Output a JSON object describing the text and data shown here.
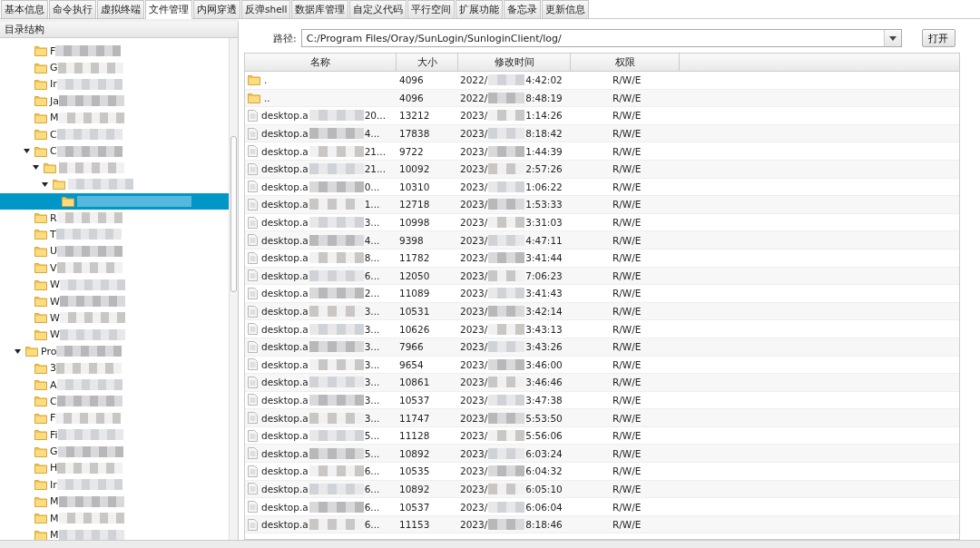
{
  "tabs": [
    {
      "label": "基本信息",
      "selected": false
    },
    {
      "label": "命令执行",
      "selected": false
    },
    {
      "label": "虚拟终端",
      "selected": false
    },
    {
      "label": "文件管理",
      "selected": true
    },
    {
      "label": "内网穿透",
      "selected": false
    },
    {
      "label": "反弹shell",
      "selected": false
    },
    {
      "label": "数据库管理",
      "selected": false
    },
    {
      "label": "自定义代码",
      "selected": false
    },
    {
      "label": "平行空间",
      "selected": false
    },
    {
      "label": "扩展功能",
      "selected": false
    },
    {
      "label": "备忘录",
      "selected": false
    },
    {
      "label": "更新信息",
      "selected": false
    }
  ],
  "tree_panel": {
    "title": "目录结构",
    "tree": [
      {
        "kind": "continued",
        "children": [
          {
            "label": "F",
            "expanded": false,
            "selected": false
          },
          {
            "label": "G",
            "expanded": false,
            "selected": false
          },
          {
            "label": "Ir",
            "expanded": false,
            "selected": false
          },
          {
            "label": "Ja",
            "expanded": false,
            "selected": false
          },
          {
            "label": "M",
            "expanded": false,
            "selected": false
          },
          {
            "label": "C",
            "expanded": false,
            "selected": false
          },
          {
            "label": "C",
            "expanded": true,
            "selected": false,
            "children": [
              {
                "expanded": true,
                "selected": false,
                "children": [
                  {
                    "expanded": true,
                    "selected": false,
                    "children": [
                      {
                        "expanded": false,
                        "selected": true
                      }
                    ]
                  }
                ]
              }
            ]
          },
          {
            "label": "R",
            "expanded": false,
            "selected": false
          },
          {
            "label": "T",
            "expanded": false,
            "selected": false
          },
          {
            "label": "U",
            "expanded": false,
            "selected": false
          },
          {
            "label": "V",
            "expanded": false,
            "selected": false
          },
          {
            "label": "W",
            "expanded": false,
            "selected": false
          },
          {
            "label": "W",
            "expanded": false,
            "selected": false
          },
          {
            "label": "W",
            "expanded": false,
            "selected": false
          },
          {
            "label": "W",
            "expanded": false,
            "selected": false
          }
        ]
      },
      {
        "kind": "folder",
        "label": "Pro",
        "expanded": true,
        "selected": false,
        "children": [
          {
            "label": "3",
            "expanded": false,
            "selected": false
          },
          {
            "label": "A",
            "expanded": false,
            "selected": false
          },
          {
            "label": "C",
            "expanded": false,
            "selected": false
          },
          {
            "label": "F",
            "expanded": false,
            "selected": false
          },
          {
            "label": "Fi",
            "expanded": false,
            "selected": false
          },
          {
            "label": "G",
            "expanded": false,
            "selected": false
          },
          {
            "label": "H",
            "expanded": false,
            "selected": false
          },
          {
            "label": "Ir",
            "expanded": false,
            "selected": false
          },
          {
            "label": "M",
            "expanded": false,
            "selected": false
          },
          {
            "label": "M",
            "expanded": false,
            "selected": false
          },
          {
            "label": "M",
            "expanded": false,
            "selected": false
          }
        ]
      }
    ]
  },
  "path_bar": {
    "label": "路径:",
    "value": "C:/Program Files/Oray/SunLogin/SunloginClient/log/",
    "button": "打开"
  },
  "table": {
    "columns": [
      "名称",
      "大小",
      "修改时间",
      "权限"
    ],
    "rows": [
      {
        "kind": "folder",
        "name": ".",
        "size": "4096",
        "date": "2022/",
        "time": "4:42:02",
        "perm": "R/W/E"
      },
      {
        "kind": "folder",
        "name": "..",
        "size": "4096",
        "date": "2022/",
        "time": "8:48:19",
        "perm": "R/W/E"
      },
      {
        "kind": "file",
        "name": "desktop.a",
        "tail": "20...",
        "size": "13212",
        "date": "2023/",
        "time": "1:14:26",
        "perm": "R/W/E"
      },
      {
        "kind": "file",
        "name": "desktop.a",
        "tail": "4...",
        "size": "17838",
        "date": "2023/",
        "time": "8:18:42",
        "perm": "R/W/E"
      },
      {
        "kind": "file",
        "name": "desktop.a",
        "tail": "21...",
        "size": "9722",
        "date": "2023/",
        "time": "1:44:39",
        "perm": "R/W/E"
      },
      {
        "kind": "file",
        "name": "desktop.a",
        "tail": "21...",
        "size": "10092",
        "date": "2023/",
        "time": "2:57:26",
        "perm": "R/W/E"
      },
      {
        "kind": "file",
        "name": "desktop.a",
        "tail": "0...",
        "size": "10310",
        "date": "2023/",
        "time": "1:06:22",
        "perm": "R/W/E"
      },
      {
        "kind": "file",
        "name": "desktop.a",
        "tail": "1...",
        "size": "12718",
        "date": "2023/",
        "time": "1:53:33",
        "perm": "R/W/E"
      },
      {
        "kind": "file",
        "name": "desktop.a",
        "tail": "3...",
        "size": "10998",
        "date": "2023/",
        "time": "3:31:03",
        "perm": "R/W/E"
      },
      {
        "kind": "file",
        "name": "desktop.a",
        "tail": "4...",
        "size": "9398",
        "date": "2023/",
        "time": "4:47:11",
        "perm": "R/W/E"
      },
      {
        "kind": "file",
        "name": "desktop.a",
        "tail": "8...",
        "size": "11782",
        "date": "2023/",
        "time": "3:41:44",
        "perm": "R/W/E"
      },
      {
        "kind": "file",
        "name": "desktop.a",
        "tail": "6...",
        "size": "12050",
        "date": "2023/",
        "time": "7:06:23",
        "perm": "R/W/E"
      },
      {
        "kind": "file",
        "name": "desktop.a",
        "tail": "2...",
        "size": "11089",
        "date": "2023/",
        "time": "3:41:43",
        "perm": "R/W/E"
      },
      {
        "kind": "file",
        "name": "desktop.a",
        "tail": "3...",
        "size": "10531",
        "date": "2023/",
        "time": "3:42:14",
        "perm": "R/W/E"
      },
      {
        "kind": "file",
        "name": "desktop.a",
        "tail": "3...",
        "size": "10626",
        "date": "2023/",
        "time": "3:43:13",
        "perm": "R/W/E"
      },
      {
        "kind": "file",
        "name": "desktop.a",
        "tail": "3...",
        "size": "7966",
        "date": "2023/",
        "time": "3:43:26",
        "perm": "R/W/E"
      },
      {
        "kind": "file",
        "name": "desktop.a",
        "tail": "3...",
        "size": "9654",
        "date": "2023/",
        "time": "3:46:00",
        "perm": "R/W/E"
      },
      {
        "kind": "file",
        "name": "desktop.a",
        "tail": "3...",
        "size": "10861",
        "date": "2023/",
        "time": "3:46:46",
        "perm": "R/W/E"
      },
      {
        "kind": "file",
        "name": "desktop.a",
        "tail": "3...",
        "size": "10537",
        "date": "2023/",
        "time": "3:47:38",
        "perm": "R/W/E"
      },
      {
        "kind": "file",
        "name": "desktop.a",
        "tail": "3...",
        "size": "11747",
        "date": "2023/",
        "time": "5:53:50",
        "perm": "R/W/E"
      },
      {
        "kind": "file",
        "name": "desktop.a",
        "tail": "5...",
        "size": "11128",
        "date": "2023/",
        "time": "5:56:06",
        "perm": "R/W/E"
      },
      {
        "kind": "file",
        "name": "desktop.a",
        "tail": "5...",
        "size": "10892",
        "date": "2023/",
        "time": "6:03:24",
        "perm": "R/W/E"
      },
      {
        "kind": "file",
        "name": "desktop.a",
        "tail": "6...",
        "size": "10535",
        "date": "2023/",
        "time": "6:04:32",
        "perm": "R/W/E"
      },
      {
        "kind": "file",
        "name": "desktop.a",
        "tail": "6...",
        "size": "10892",
        "date": "2023/",
        "time": "6:05:10",
        "perm": "R/W/E"
      },
      {
        "kind": "file",
        "name": "desktop.a",
        "tail": "6...",
        "size": "10537",
        "date": "2023/",
        "time": "6:06:04",
        "perm": "R/W/E"
      },
      {
        "kind": "file",
        "name": "desktop.a",
        "tail": "6...",
        "size": "11153",
        "date": "2023/",
        "time": "8:18:46",
        "perm": "R/W/E"
      }
    ]
  }
}
